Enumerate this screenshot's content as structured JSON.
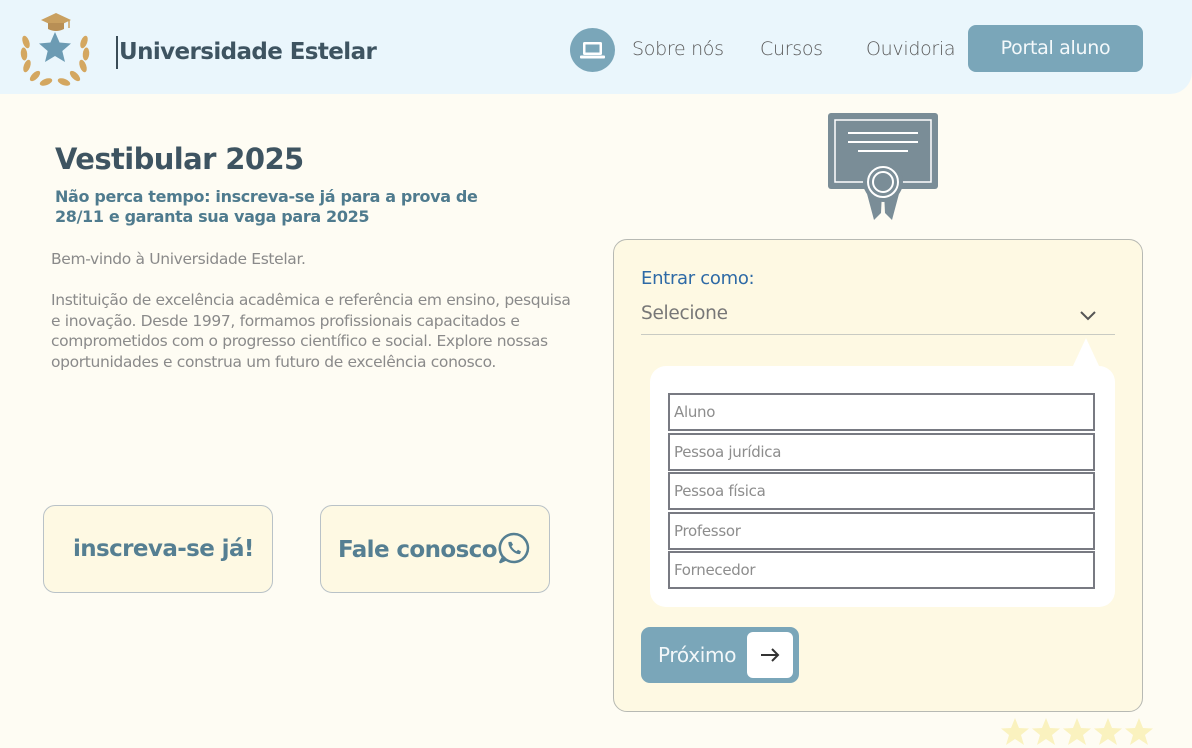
{
  "brand": {
    "name": "Universidade Estelar"
  },
  "nav": {
    "icon": "laptop-icon",
    "links": [
      "Sobre nós",
      "Cursos",
      "Ouvidoria"
    ],
    "portal_label": "Portal aluno"
  },
  "hero": {
    "title": "Vestibular 2025",
    "subtitle": "Não perca tempo: inscreva-se já para a prova de 28/11 e garanta sua vaga para 2025",
    "welcome": "Bem-vindo à Universidade Estelar.",
    "description": "Instituição de excelência acadêmica e referência em ensino, pesquisa e inovação. Desde 1997, formamos profissionais capacitados e comprometidos com o progresso científico e social. Explore nossas oportunidades e construa um futuro de excelência conosco."
  },
  "actions": {
    "enroll_label": "inscreva-se já!",
    "contact_label": "Fale conosco",
    "contact_icon": "whatsapp-icon"
  },
  "login": {
    "icon": "certificate-icon",
    "label": "Entrar como:",
    "placeholder": "Selecione",
    "options": [
      "Aluno",
      "Pessoa jurídica",
      "Pessoa física",
      "Professor",
      "Fornecedor"
    ],
    "next_label": "Próximo",
    "next_icon": "arrow-right-icon"
  },
  "rating": {
    "stars": 5,
    "icon": "star-icon"
  },
  "colors": {
    "accent": "#7aa6b9",
    "brand_text": "#3e5461",
    "header_bg": "#eaf6fc",
    "page_bg": "#fefcf3",
    "panel_bg": "#fef9e3",
    "gold": "#d4a760",
    "star": "#faf2bf"
  }
}
